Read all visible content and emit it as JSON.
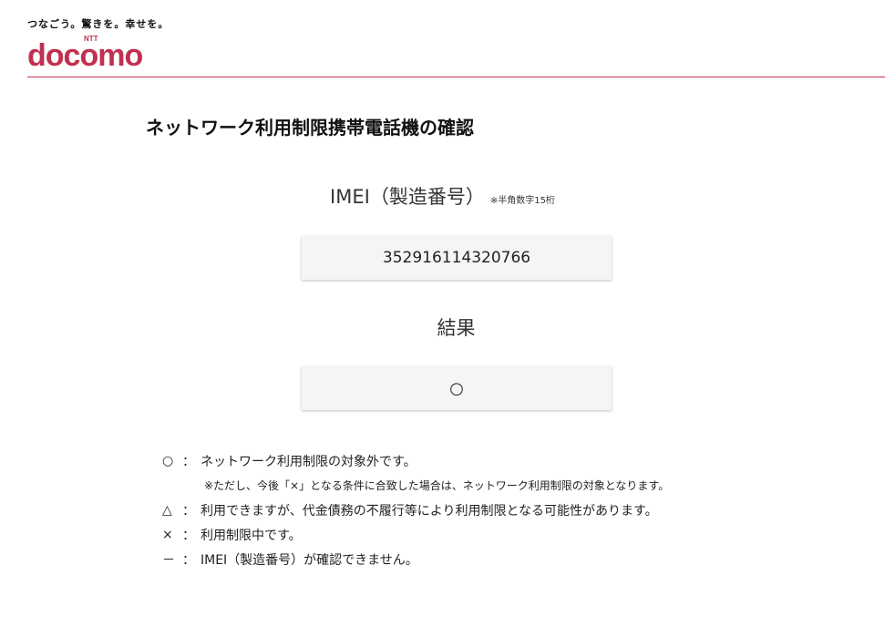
{
  "header": {
    "tagline": "つなごう。驚きを。幸せを。",
    "logo_small": "NTT",
    "logo_text": "docomo",
    "brand_color": "#c0314f"
  },
  "page": {
    "title": "ネットワーク利用制限携帯電話機の確認"
  },
  "imei": {
    "label": "IMEI（製造番号）",
    "note": "※半角数字15桁",
    "value": "352916114320766"
  },
  "result": {
    "label": "結果",
    "value": "○"
  },
  "legend": {
    "rows": [
      {
        "symbol": "○",
        "colon": "：",
        "text": "ネットワーク利用制限の対象外です。"
      },
      {
        "symbol": "△",
        "colon": "：",
        "text": "利用できますが、代金債務の不履行等により利用制限となる可能性があります。"
      },
      {
        "symbol": "×",
        "colon": "：",
        "text": "利用制限中です。"
      },
      {
        "symbol": "－",
        "colon": "：",
        "text": "IMEI（製造番号）が確認できません。"
      }
    ],
    "note": "※ただし、今後「×」となる条件に合致した場合は、ネットワーク利用制限の対象となります。"
  }
}
